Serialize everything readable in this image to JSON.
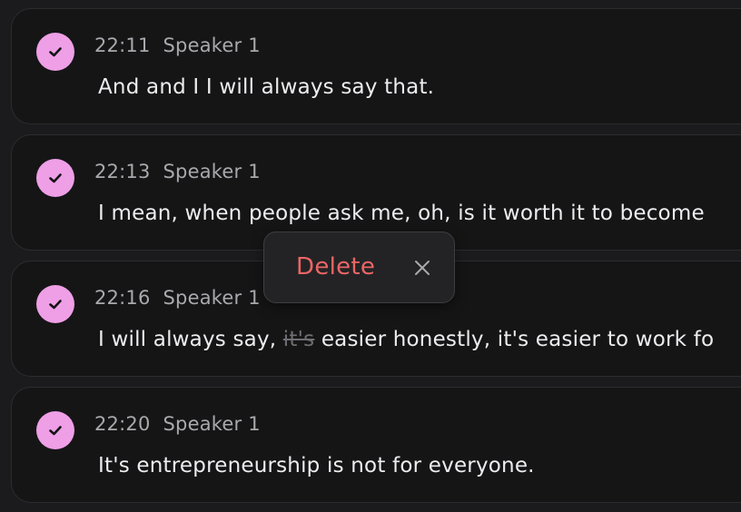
{
  "transcript": {
    "segments": [
      {
        "time": "22:11",
        "speaker": "Speaker 1",
        "text": "And and I I will always say that."
      },
      {
        "time": "22:13",
        "speaker": "Speaker 1",
        "text": "I mean, when people ask me, oh, is it worth it to become"
      },
      {
        "time": "22:16",
        "speaker": "Speaker 1",
        "text_before": "I will always say, ",
        "text_struck": "it's",
        "text_after": " easier honestly, it's easier to work fo"
      },
      {
        "time": "22:20",
        "speaker": "Speaker 1",
        "text": "It's entrepreneurship is not for everyone."
      }
    ]
  },
  "popover": {
    "delete_label": "Delete",
    "close_icon": "close-icon"
  },
  "colors": {
    "accent": "#ee9fe6",
    "danger": "#ec6565",
    "card_bg": "#151516",
    "page_bg": "#1b1b1d"
  }
}
